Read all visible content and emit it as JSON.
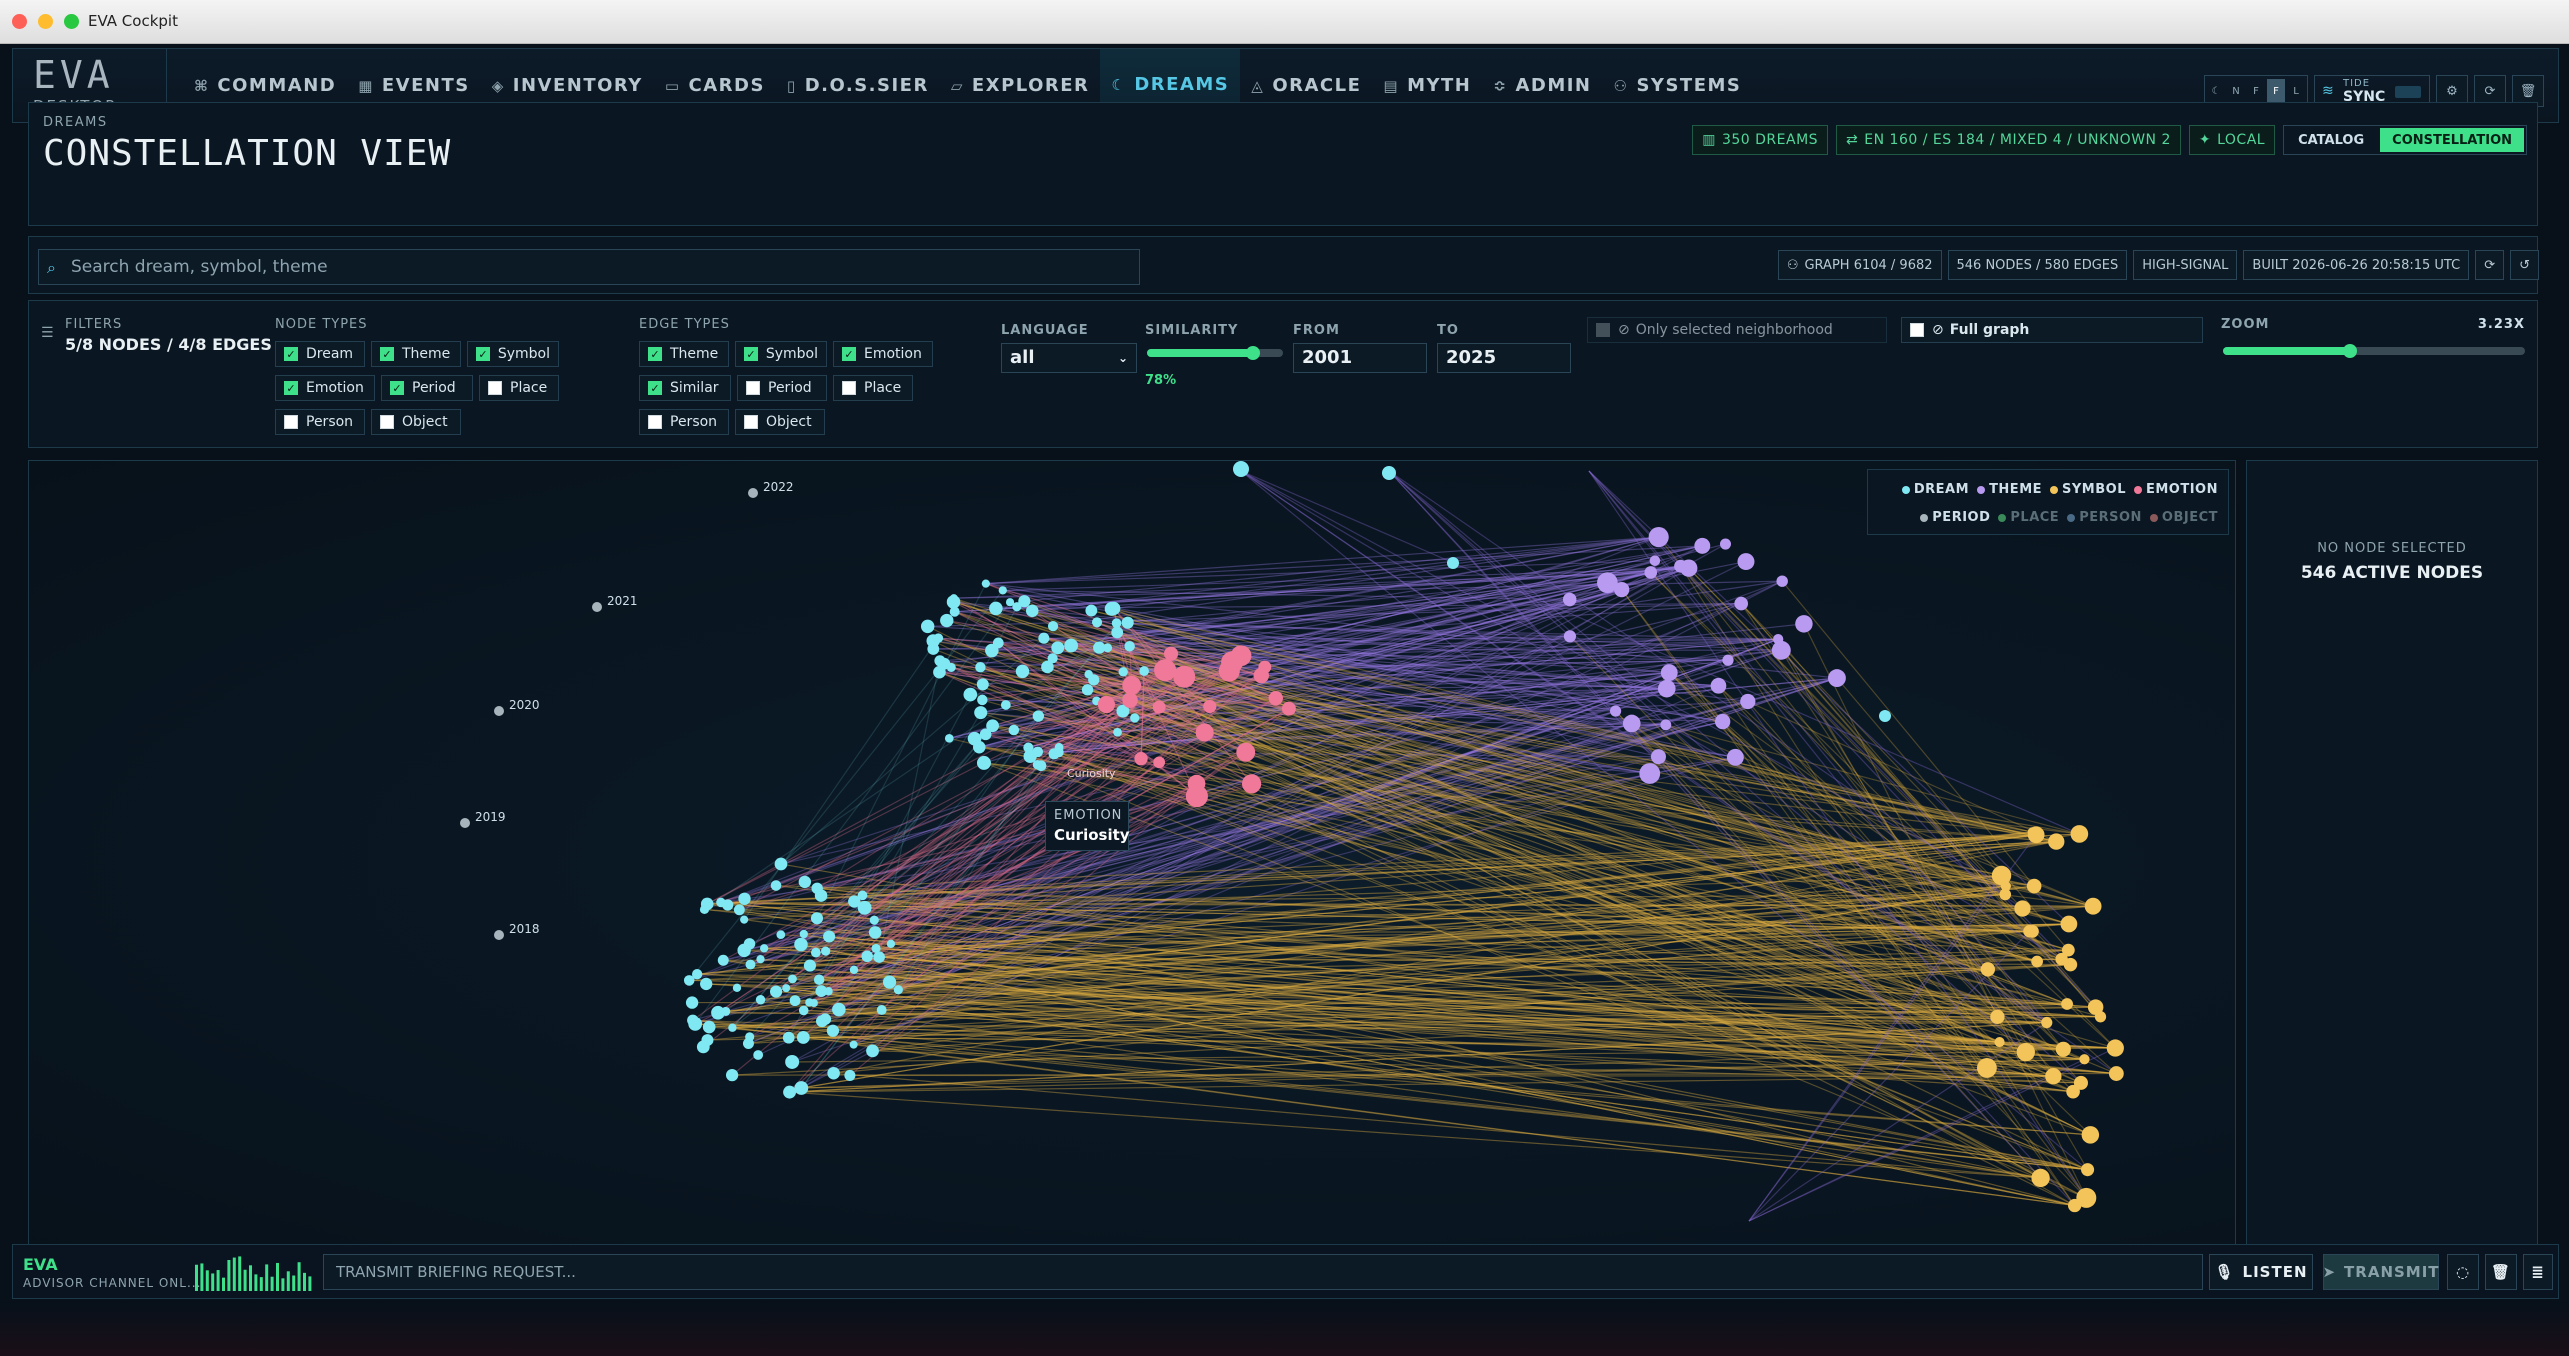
{
  "window": {
    "title": "EVA Cockpit"
  },
  "logo": {
    "big": "EVA",
    "small": "DESKTOP"
  },
  "nav": [
    {
      "label": "COMMAND",
      "icon": "command-icon"
    },
    {
      "label": "EVENTS",
      "icon": "calendar-icon"
    },
    {
      "label": "INVENTORY",
      "icon": "cube-icon"
    },
    {
      "label": "CARDS",
      "icon": "cards-icon"
    },
    {
      "label": "D.O.S.SIER",
      "icon": "file-icon"
    },
    {
      "label": "EXPLORER",
      "icon": "folder-icon"
    },
    {
      "label": "DREAMS",
      "icon": "moon-icon",
      "active": true
    },
    {
      "label": "ORACLE",
      "icon": "oracle-icon"
    },
    {
      "label": "MYTH",
      "icon": "book-icon"
    },
    {
      "label": "ADMIN",
      "icon": "sliders-icon"
    },
    {
      "label": "SYSTEMS",
      "icon": "network-icon"
    }
  ],
  "toolbar": {
    "mode_buttons": [
      "N",
      "F",
      "F",
      "L"
    ],
    "tide_label": "TIDE",
    "tide_value": "SYNC"
  },
  "header": {
    "section": "DREAMS",
    "title": "CONSTELLATION VIEW",
    "stats": [
      "350 DREAMS",
      "EN 160 / ES 184 / MIXED 4 / UNKNOWN 2",
      "LOCAL"
    ],
    "views": [
      "CATALOG",
      "CONSTELLATION"
    ],
    "active_view": "CONSTELLATION"
  },
  "search": {
    "placeholder": "Search dream, symbol, theme"
  },
  "graph_info": [
    "GRAPH 6104 / 9682",
    "546 NODES / 580 EDGES",
    "HIGH-SIGNAL",
    "BUILT 2026-06-26 20:58:15 UTC"
  ],
  "filters": {
    "label": "FILTERS",
    "summary": "5/8 NODES / 4/8 EDGES",
    "node_types_label": "NODE TYPES",
    "node_types": [
      {
        "label": "Dream",
        "checked": true
      },
      {
        "label": "Theme",
        "checked": true
      },
      {
        "label": "Symbol",
        "checked": true
      },
      {
        "label": "Emotion",
        "checked": true
      },
      {
        "label": "Period",
        "checked": true
      },
      {
        "label": "Place",
        "checked": false
      },
      {
        "label": "Person",
        "checked": false
      },
      {
        "label": "Object",
        "checked": false
      }
    ],
    "edge_types_label": "EDGE TYPES",
    "edge_types": [
      {
        "label": "Theme",
        "checked": true
      },
      {
        "label": "Symbol",
        "checked": true
      },
      {
        "label": "Emotion",
        "checked": true
      },
      {
        "label": "Similar",
        "checked": true
      },
      {
        "label": "Period",
        "checked": false
      },
      {
        "label": "Place",
        "checked": false
      },
      {
        "label": "Person",
        "checked": false
      },
      {
        "label": "Object",
        "checked": false
      }
    ],
    "language_label": "LANGUAGE",
    "language_value": "all",
    "similarity_label": "SIMILARITY",
    "similarity_value": "78%",
    "similarity_fraction": 0.78,
    "from_label": "FROM",
    "from_value": "2001",
    "to_label": "TO",
    "to_value": "2025",
    "neighborhood_label": "Only selected neighborhood",
    "full_graph_label": "Full graph",
    "zoom_label": "ZOOM",
    "zoom_value": "3.23X",
    "zoom_fraction": 0.42
  },
  "legend": {
    "row1": [
      {
        "label": "DREAM",
        "color": "#7fe8f2"
      },
      {
        "label": "THEME",
        "color": "#b89af0"
      },
      {
        "label": "SYMBOL",
        "color": "#f2c45a"
      },
      {
        "label": "EMOTION",
        "color": "#f07898"
      }
    ],
    "row2": [
      {
        "label": "PERIOD",
        "color": "#a8b4bc",
        "active": true
      },
      {
        "label": "PLACE",
        "color": "#3a8a5a",
        "active": false
      },
      {
        "label": "PERSON",
        "color": "#4a6a86",
        "active": false
      },
      {
        "label": "OBJECT",
        "color": "#8a5a5a",
        "active": false
      }
    ]
  },
  "periods": [
    "2022",
    "2021",
    "2020",
    "2019",
    "2018"
  ],
  "hover_label": "Curiosity",
  "tooltip": {
    "type": "EMOTION",
    "name": "Curiosity"
  },
  "side": {
    "line1": "NO NODE SELECTED",
    "line2": "546 ACTIVE NODES"
  },
  "bottom": {
    "name": "EVA",
    "channel": "ADVISOR CHANNEL ONL...",
    "placeholder": "TRANSMIT BRIEFING REQUEST...",
    "listen": "LISTEN",
    "transmit": "TRANSMIT"
  },
  "colors": {
    "accent": "#56c8e6",
    "green": "#3ee08a"
  }
}
